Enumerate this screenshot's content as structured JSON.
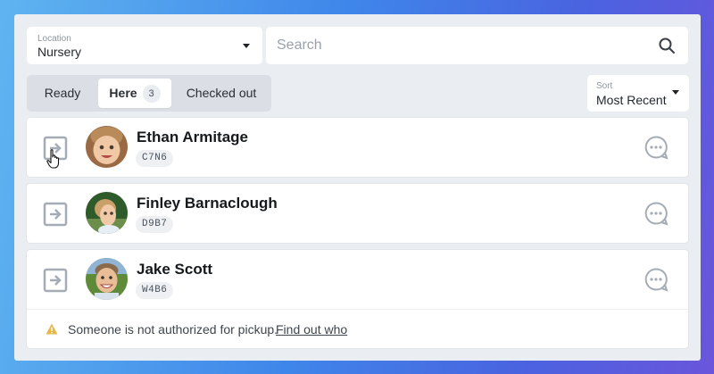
{
  "location": {
    "label": "Location",
    "value": "Nursery",
    "icon": "chevron-down-icon"
  },
  "search": {
    "placeholder": "Search",
    "icon": "search-icon"
  },
  "tabs": [
    {
      "label": "Ready"
    },
    {
      "label": "Here",
      "count": "3",
      "active": true
    },
    {
      "label": "Checked out"
    }
  ],
  "sort": {
    "label": "Sort",
    "value": "Most Recent"
  },
  "people": [
    {
      "name": "Ethan Armitage",
      "code": "C7N6"
    },
    {
      "name": "Finley Barnaclough",
      "code": "D9B7"
    },
    {
      "name": "Jake Scott",
      "code": "W4B6"
    }
  ],
  "warning": {
    "text": "Someone is not authorized for pickup.",
    "link": "Find out who",
    "color": "#e6b84a"
  },
  "colors": {
    "icon_gray": "#a5acb5",
    "accent": "#3f86ea"
  }
}
